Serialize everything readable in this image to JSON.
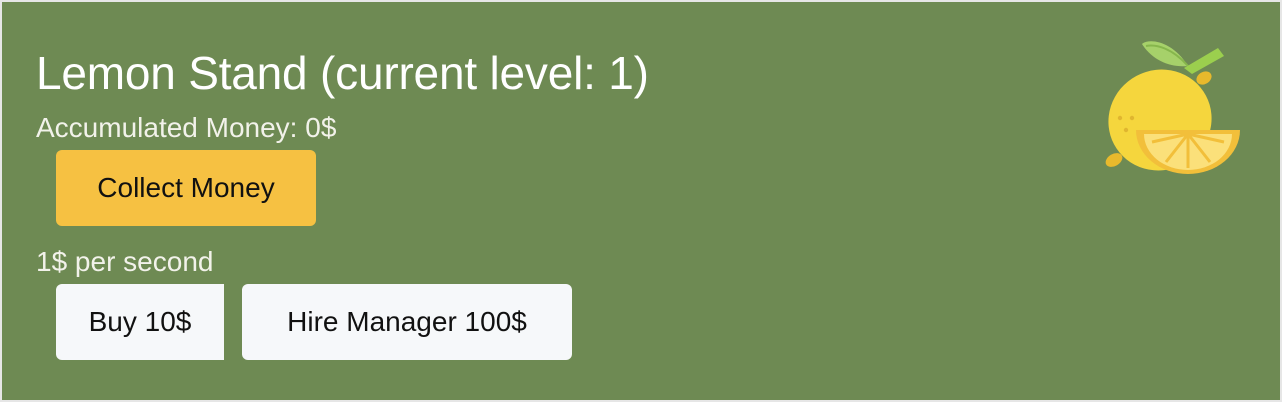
{
  "stand": {
    "title": "Lemon Stand (current level: 1)",
    "accumulated_money": "Accumulated Money: 0$",
    "collect_label": "Collect Money",
    "rate": "1$ per second",
    "buy_label": "Buy 10$",
    "hire_label": "Hire Manager 100$",
    "icon": "lemon-icon"
  },
  "colors": {
    "card_background": "#6e8a53",
    "collect_button": "#f6c142",
    "secondary_button": "#f6f8fa",
    "lemon": "#f5d63d"
  }
}
